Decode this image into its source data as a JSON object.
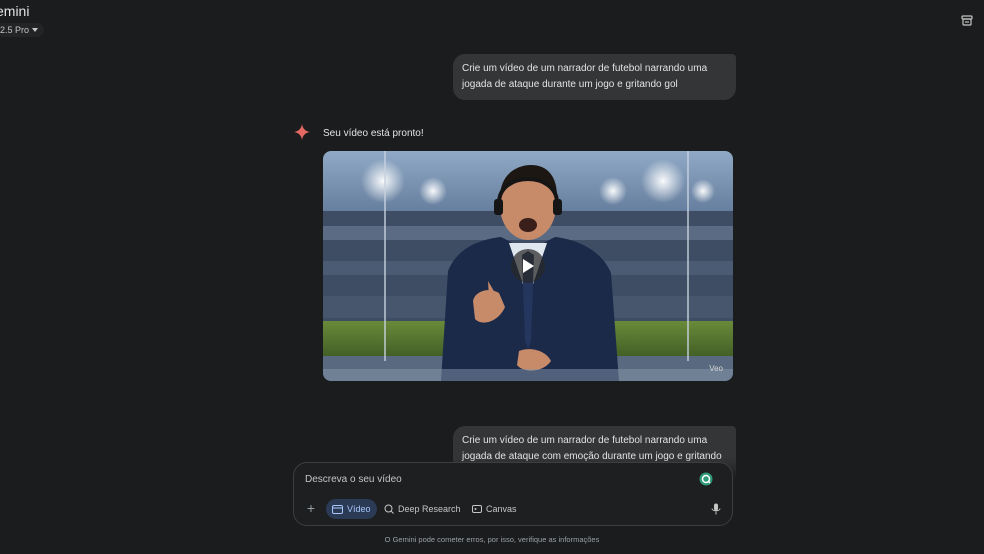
{
  "header": {
    "app_title": "emini",
    "model_label": "2.5 Pro"
  },
  "conversation": {
    "user_prompt_1": "Crie um vídeo de um narrador de futebol narrando uma jogada de ataque durante um jogo e gritando gol",
    "reply_text": "Seu vídeo está pronto!",
    "video_badge": "Veo",
    "user_prompt_2": "Crie um vídeo de um narrador de futebol narrando uma jogada de ataque com emoção durante um jogo e gritando"
  },
  "composer": {
    "placeholder": "Descreva o seu vídeo",
    "tools": {
      "video": "Vídeo",
      "deep_research": "Deep Research",
      "canvas": "Canvas"
    }
  },
  "footer": {
    "disclaimer": "O Gemini pode cometer erros, por isso, verifique as informações"
  },
  "colors": {
    "background": "#1b1c1d",
    "bubble": "#333537",
    "accent_blue": "#a8c7fa",
    "spark": "#e46962"
  }
}
